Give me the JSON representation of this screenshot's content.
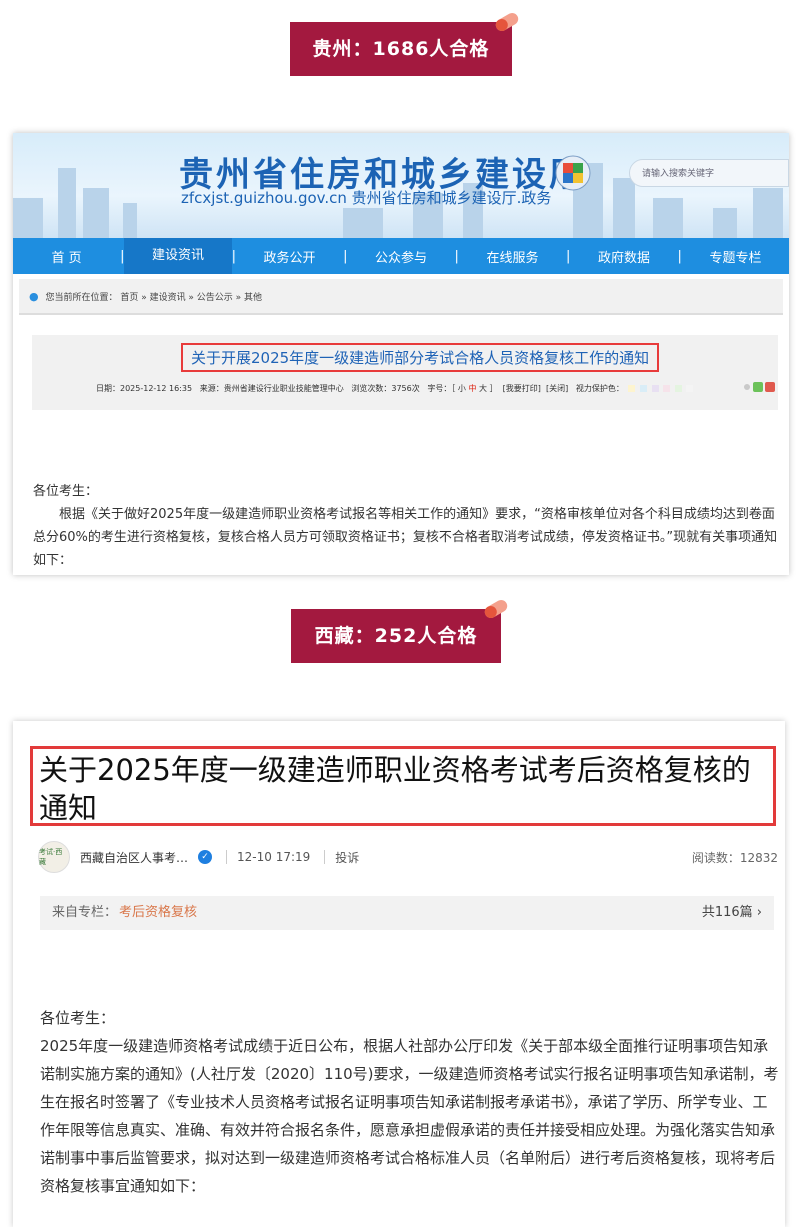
{
  "tag1": {
    "text": "贵州：1686人合格"
  },
  "tag2": {
    "text": "西藏：252人合格"
  },
  "guizhou": {
    "site_title": "贵州省住房和城乡建设厅",
    "site_sub": "zfcxjst.guizhou.gov.cn 贵州省住房和城乡建设厅.政务",
    "search_placeholder": "请输入搜索关键字",
    "nav": [
      "首 页",
      "建设资讯",
      "政务公开",
      "公众参与",
      "在线服务",
      "政府数据",
      "专题专栏"
    ],
    "breadcrumb": "您当前所在位置：  首页 » 建设资讯 » 公告公示 » 其他",
    "notice_title": "关于开展2025年度一级建造师部分考试合格人员资格复核工作的通知",
    "meta": {
      "date": "日期：2025-12-12 16:35",
      "source": "来源：贵州省建设行业职业技能管理中心",
      "views": "浏览次数：3756次",
      "font_label": "字号：［",
      "font_small": "小",
      "font_mid": "中",
      "font_large": "大",
      "font_close": "］",
      "print": "[我要打印]",
      "close": "[关闭]",
      "eye": "视力保护色："
    },
    "eye_colors": [
      "#fdf4cf",
      "#d9edf7",
      "#e8e0f2",
      "#f6e3ea",
      "#e4f4e0",
      "#f4f4f4"
    ],
    "greeting": "各位考生：",
    "para": "根据《关于做好2025年度一级建造师职业资格考试报名等相关工作的通知》要求，“资格审核单位对各个科目成绩均达到卷面总分60%的考生进行资格复核，复核合格人员方可领取资格证书；复核不合格者取消考试成绩，停发资格证书。”现就有关事项通知如下："
  },
  "tibet": {
    "title": "关于2025年度一级建造师职业资格考试考后资格复核的通知",
    "avatar_text": "考试·西藏",
    "account": "西藏自治区人事考…",
    "verified": "✓",
    "time": "12-10 17:19",
    "complain": "投诉",
    "reads": "阅读数：12832",
    "column_label": "来自专栏：",
    "column_name": "考后资格复核",
    "column_count": "共116篇 ›",
    "greeting": "各位考生：",
    "para": "2025年度一级建造师资格考试成绩于近日公布，根据人社部办公厅印发《关于部本级全面推行证明事项告知承诺制实施方案的通知》(人社厅发〔2020〕110号)要求，一级建造师资格考试实行报名证明事项告知承诺制，考生在报名时签署了《专业技术人员资格考试报名证明事项告知承诺制报考承诺书》，承诺了学历、所学专业、工作年限等信息真实、准确、有效并符合报名条件，愿意承担虚假承诺的责任并接受相应处理。为强化落实告知承诺制事中事后监管要求，拟对达到一级建造师资格考试合格标准人员（名单附后）进行考后资格复核，现将考后资格复核事宜通知如下："
  },
  "colors": {
    "tag_bg": "#a3193f",
    "nav_bg": "#1e8ee0",
    "highlight": "#e23a3a",
    "link_blue": "#1f63b6"
  }
}
